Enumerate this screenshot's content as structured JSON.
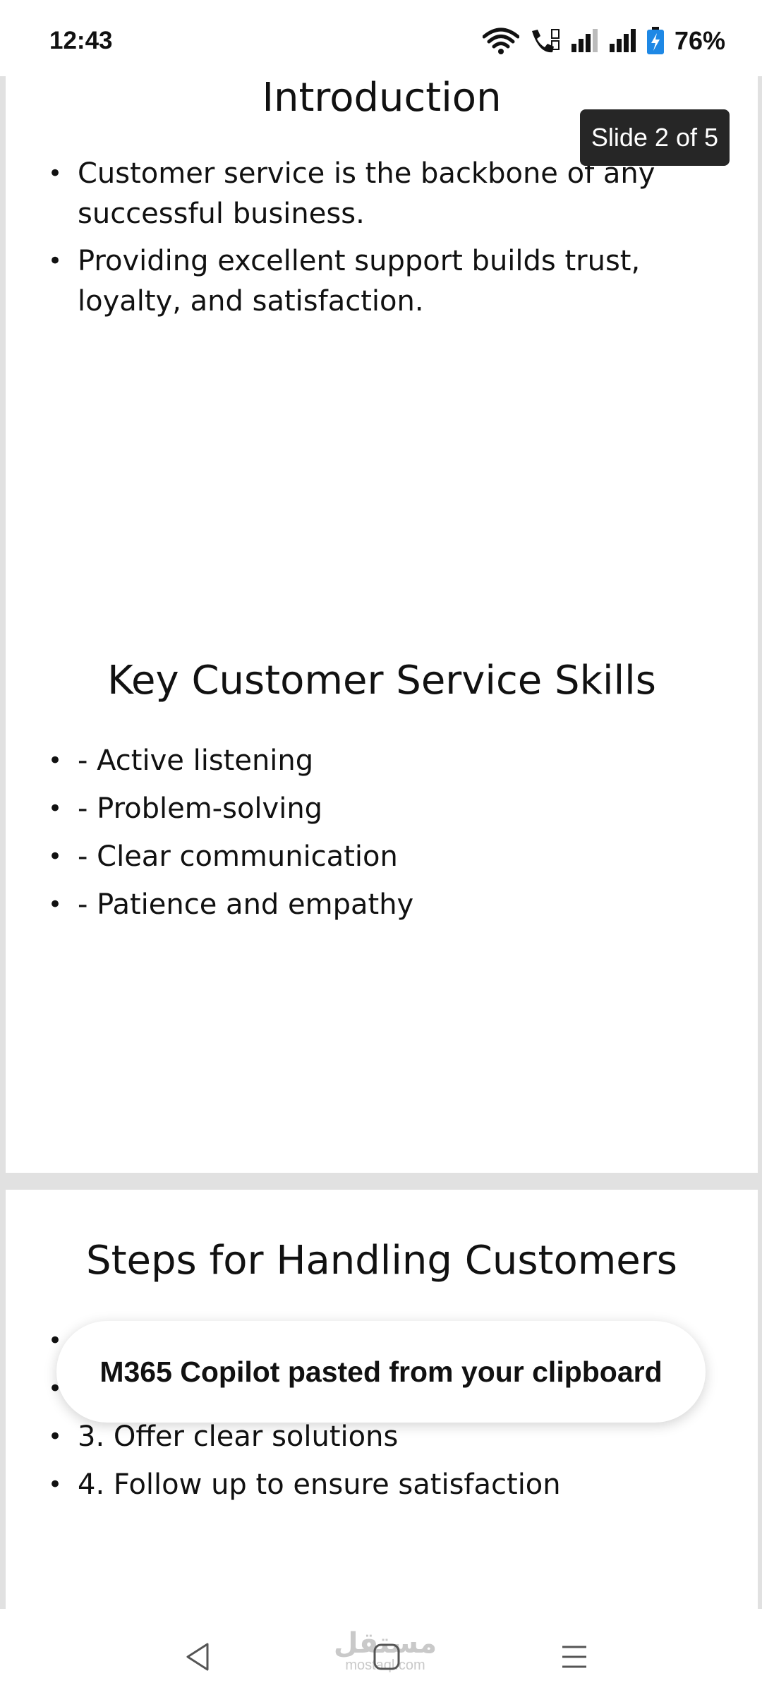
{
  "status_bar": {
    "time": "12:43",
    "battery": "76%",
    "icons": [
      "wifi-icon",
      "wifi-calling-icon",
      "signal-sim1-icon",
      "signal-sim2-icon",
      "battery-charging-icon"
    ]
  },
  "slide_counter": "Slide 2 of 5",
  "slides": [
    {
      "title": "Introduction",
      "bullets": [
        "Customer service is the backbone of any successful business.",
        "Providing excellent support builds trust, loyalty, and satisfaction."
      ]
    },
    {
      "title": "Key Customer Service Skills",
      "bullets": [
        "- Active listening",
        "- Problem-solving",
        "- Clear communication",
        "- Patience and empathy"
      ]
    },
    {
      "title": "Steps for Handling Customers",
      "bullets": [
        "",
        "",
        "3. Offer clear solutions",
        "4. Follow up to ensure satisfaction"
      ]
    }
  ],
  "toast": "M365 Copilot pasted from your clipboard",
  "watermark": {
    "arabic": "مستقل",
    "latin": "mostaql.com"
  },
  "nav_bar": [
    "back-icon",
    "home-icon",
    "recents-icon"
  ],
  "colors": {
    "background_gray": "#e1e1e1",
    "counter_bg": "#262626",
    "battery_accent": "#1e88e5"
  }
}
